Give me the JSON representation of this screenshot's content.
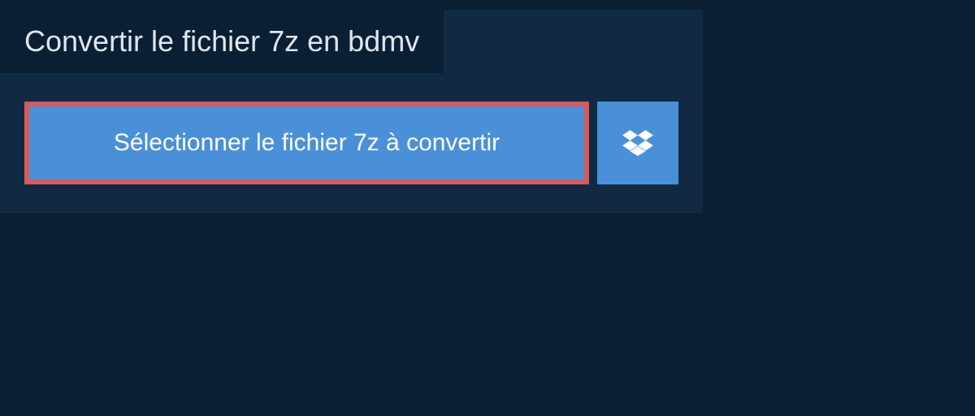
{
  "header": {
    "title": "Convertir le fichier 7z en bdmv"
  },
  "actions": {
    "select_file_label": "Sélectionner le fichier 7z à convertir"
  },
  "colors": {
    "page_bg": "#0a1f33",
    "panel_bg": "#102a43",
    "button_bg": "#4a90d9",
    "highlight_border": "#d85a5a",
    "text_light": "#e0e6ed",
    "text_white": "#ffffff"
  }
}
